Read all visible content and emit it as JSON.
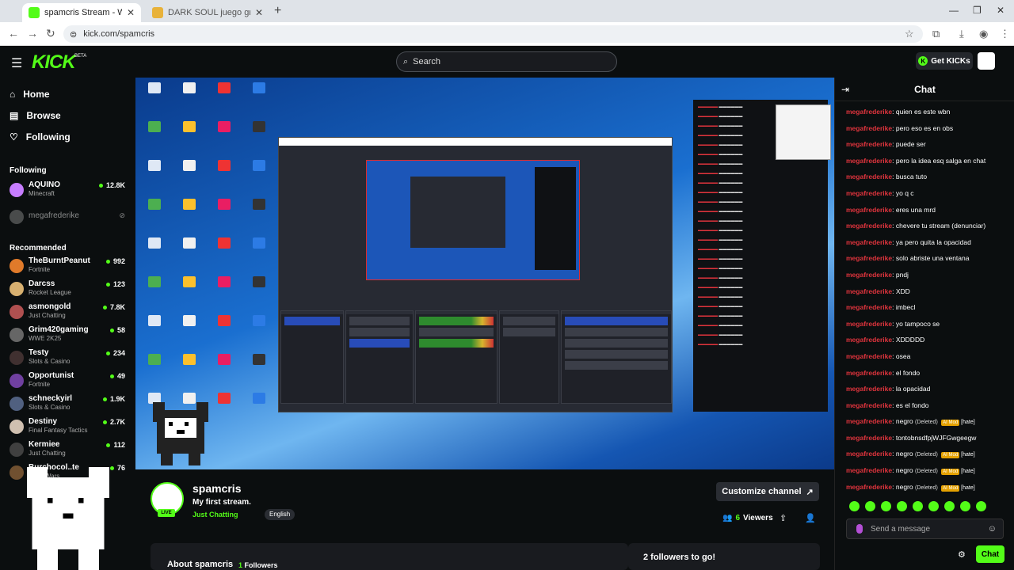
{
  "browser": {
    "tabs": [
      {
        "title": "spamcris Stream - Watch Live o",
        "active": true,
        "fav_color": "#53fc18"
      },
      {
        "title": "DARK SOUL juego gratis online",
        "active": false,
        "fav_color": "#e8b23a"
      }
    ],
    "url": "kick.com/spamcris"
  },
  "header": {
    "logo": "KICK",
    "beta": "BETA",
    "search_placeholder": "Search",
    "get_kicks": "Get KICKs"
  },
  "sidebar": {
    "nav": [
      "Home",
      "Browse",
      "Following"
    ],
    "following_title": "Following",
    "following": [
      {
        "name": "AQUINO",
        "category": "Minecraft",
        "viewers": "12.8K",
        "color": "#c77dff"
      },
      {
        "name": "megafrederike",
        "category": "",
        "viewers": "",
        "color": "#888"
      }
    ],
    "recommended_title": "Recommended",
    "recommended": [
      {
        "name": "TheBurntPeanut",
        "category": "Fortnite",
        "viewers": "992",
        "color": "#e07a2a"
      },
      {
        "name": "Darcss",
        "category": "Rocket League",
        "viewers": "123",
        "color": "#d8b070"
      },
      {
        "name": "asmongold",
        "category": "Just Chatting",
        "viewers": "7.8K",
        "color": "#b05050"
      },
      {
        "name": "Grim420gaming",
        "category": "WWE 2K25",
        "viewers": "58",
        "color": "#666"
      },
      {
        "name": "Testy",
        "category": "Slots & Casino",
        "viewers": "234",
        "color": "#403030"
      },
      {
        "name": "Opportunist",
        "category": "Fortnite",
        "viewers": "49",
        "color": "#7040a0"
      },
      {
        "name": "schneckyirl",
        "category": "Slots & Casino",
        "viewers": "1.9K",
        "color": "#506080"
      },
      {
        "name": "Destiny",
        "category": "Final Fantasy Tactics",
        "viewers": "2.7K",
        "color": "#d0c0b0"
      },
      {
        "name": "Kermiee",
        "category": "Just Chatting",
        "viewers": "112",
        "color": "#404040"
      },
      {
        "name": "Burchocol..te",
        "category": "Guild Wars",
        "viewers": "76",
        "color": "#705030"
      }
    ]
  },
  "stream": {
    "channel": "spamcris",
    "title": "My first stream.",
    "category": "Just Chatting",
    "language": "English",
    "live": "LIVE",
    "customize": "Customize channel",
    "viewers_count": "6",
    "viewers_label": "Viewers",
    "about_label": "About spamcris",
    "followers_count": "1",
    "followers_label": "Followers",
    "goal": "2 followers to go!"
  },
  "chat": {
    "title": "Chat",
    "messages": [
      {
        "user": "megafrederike",
        "text": "quien es este wbn"
      },
      {
        "user": "megafrederike",
        "text": "pero eso es en obs"
      },
      {
        "user": "megafrederike",
        "text": "puede ser"
      },
      {
        "user": "megafrederike",
        "text": "pero la idea esq salga en chat"
      },
      {
        "user": "megafrederike",
        "text": "busca tuto"
      },
      {
        "user": "megafrederike",
        "text": "yo q c"
      },
      {
        "user": "megafrederike",
        "text": "eres una mrd"
      },
      {
        "user": "megafrederike",
        "text": "chevere tu stream (denunciar)"
      },
      {
        "user": "megafrederike",
        "text": "ya pero quita la opacidad"
      },
      {
        "user": "megafrederike",
        "text": "solo abriste una ventana"
      },
      {
        "user": "megafrederike",
        "text": "pndj"
      },
      {
        "user": "megafrederike",
        "text": "XDD"
      },
      {
        "user": "megafrederike",
        "text": "imbecl"
      },
      {
        "user": "megafrederike",
        "text": "yo tampoco se"
      },
      {
        "user": "megafrederike",
        "text": "XDDDDD"
      },
      {
        "user": "megafrederike",
        "text": "osea"
      },
      {
        "user": "megafrederike",
        "text": "el fondo"
      },
      {
        "user": "megafrederike",
        "text": "la opacidad"
      },
      {
        "user": "megafrederike",
        "text": "es el fondo"
      },
      {
        "user": "megafrederike",
        "text": "negro",
        "deleted": "(Deleted)",
        "mod": "AI Mod",
        "tag": "[hate]"
      },
      {
        "user": "megafrederike",
        "text": "tontobnsdfpjWJFGwgeegw"
      },
      {
        "user": "megafrederike",
        "text": "negro",
        "deleted": "(Deleted)",
        "mod": "AI Mod",
        "tag": "[hate]"
      },
      {
        "user": "megafrederike",
        "text": "negro",
        "deleted": "(Deleted)",
        "mod": "AI Mod",
        "tag": "[hate]"
      },
      {
        "user": "megafrederike",
        "text": "negro",
        "deleted": "(Deleted)",
        "mod": "AI Mod",
        "tag": "[hate]"
      }
    ],
    "input_placeholder": "Send a message",
    "send": "Chat"
  }
}
